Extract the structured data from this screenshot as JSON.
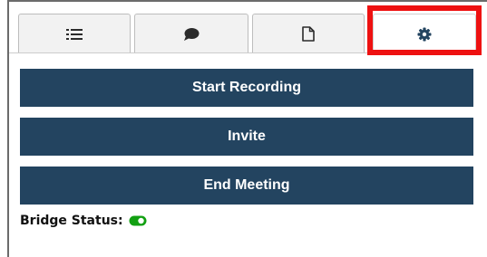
{
  "tabs": [
    {
      "icon": "list-icon",
      "active": false
    },
    {
      "icon": "chat-bubble-icon",
      "active": false
    },
    {
      "icon": "document-icon",
      "active": false
    },
    {
      "icon": "gear-icon",
      "active": true
    }
  ],
  "buttons": {
    "start_recording": "Start Recording",
    "invite": "Invite",
    "end_meeting": "End Meeting"
  },
  "bridge": {
    "label": "Bridge Status:",
    "enabled": true
  },
  "colors": {
    "button_bg": "#234460",
    "toggle_on": "#12a012",
    "highlight": "#ee1111",
    "tab_icon": "#2b2b2b",
    "active_tab_icon": "#234460"
  }
}
